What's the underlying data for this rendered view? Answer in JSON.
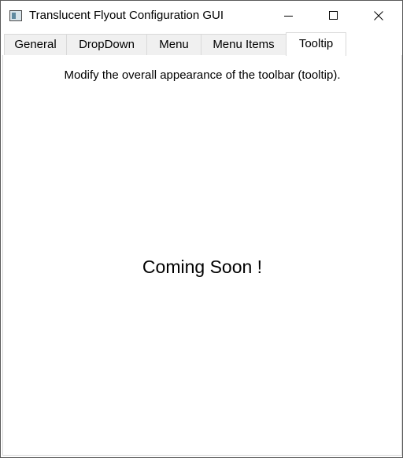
{
  "window": {
    "title": "Translucent Flyout Configuration GUI",
    "icon": "app-window-icon",
    "controls": [
      "minimize-icon",
      "maximize-icon",
      "close-icon"
    ]
  },
  "tabs": [
    {
      "label": "General",
      "selected": false
    },
    {
      "label": "DropDown",
      "selected": false
    },
    {
      "label": "Menu",
      "selected": false
    },
    {
      "label": "Menu Items",
      "selected": false
    },
    {
      "label": "Tooltip",
      "selected": true
    }
  ],
  "tooltip_page": {
    "description": "Modify the overall appearance of the toolbar (tooltip).",
    "placeholder": "Coming Soon !"
  }
}
